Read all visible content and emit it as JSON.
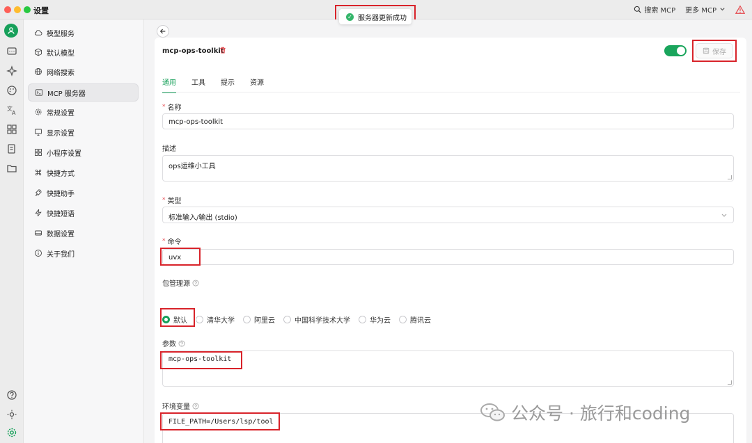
{
  "window": {
    "title": "设置"
  },
  "titlebar": {
    "search_mcp": "搜索 MCP",
    "more_mcp": "更多 MCP"
  },
  "toast": {
    "message": "服务器更新成功"
  },
  "nav": {
    "items": [
      {
        "label": "模型服务"
      },
      {
        "label": "默认模型"
      },
      {
        "label": "网络搜索"
      },
      {
        "label": "MCP 服务器"
      },
      {
        "label": "常规设置"
      },
      {
        "label": "显示设置"
      },
      {
        "label": "小程序设置"
      },
      {
        "label": "快捷方式"
      },
      {
        "label": "快捷助手"
      },
      {
        "label": "快捷短语"
      },
      {
        "label": "数据设置"
      },
      {
        "label": "关于我们"
      }
    ]
  },
  "server": {
    "name": "mcp-ops-toolkit",
    "enabled": true,
    "save_label": "保存"
  },
  "tabs": [
    {
      "label": "通用"
    },
    {
      "label": "工具"
    },
    {
      "label": "提示"
    },
    {
      "label": "资源"
    }
  ],
  "form": {
    "name_label": "名称",
    "name_value": "mcp-ops-toolkit",
    "desc_label": "描述",
    "desc_value": "ops运维小工具",
    "type_label": "类型",
    "type_value": "标准输入/输出 (stdio)",
    "command_label": "命令",
    "command_value": "uvx",
    "registry_label": "包管理源",
    "registry_options": [
      {
        "label": "默认"
      },
      {
        "label": "清华大学"
      },
      {
        "label": "阿里云"
      },
      {
        "label": "中国科学技术大学"
      },
      {
        "label": "华为云"
      },
      {
        "label": "腾讯云"
      }
    ],
    "registry_selected": "默认",
    "args_label": "参数",
    "args_value": "mcp-ops-toolkit",
    "env_label": "环境变量",
    "env_value": "FILE_PATH=/Users/lsp/tool"
  },
  "watermark": {
    "text": "公众号 · 旅行和coding"
  },
  "colors": {
    "accent": "#17a05a",
    "highlight": "#d8232a",
    "danger": "#e5484d"
  }
}
